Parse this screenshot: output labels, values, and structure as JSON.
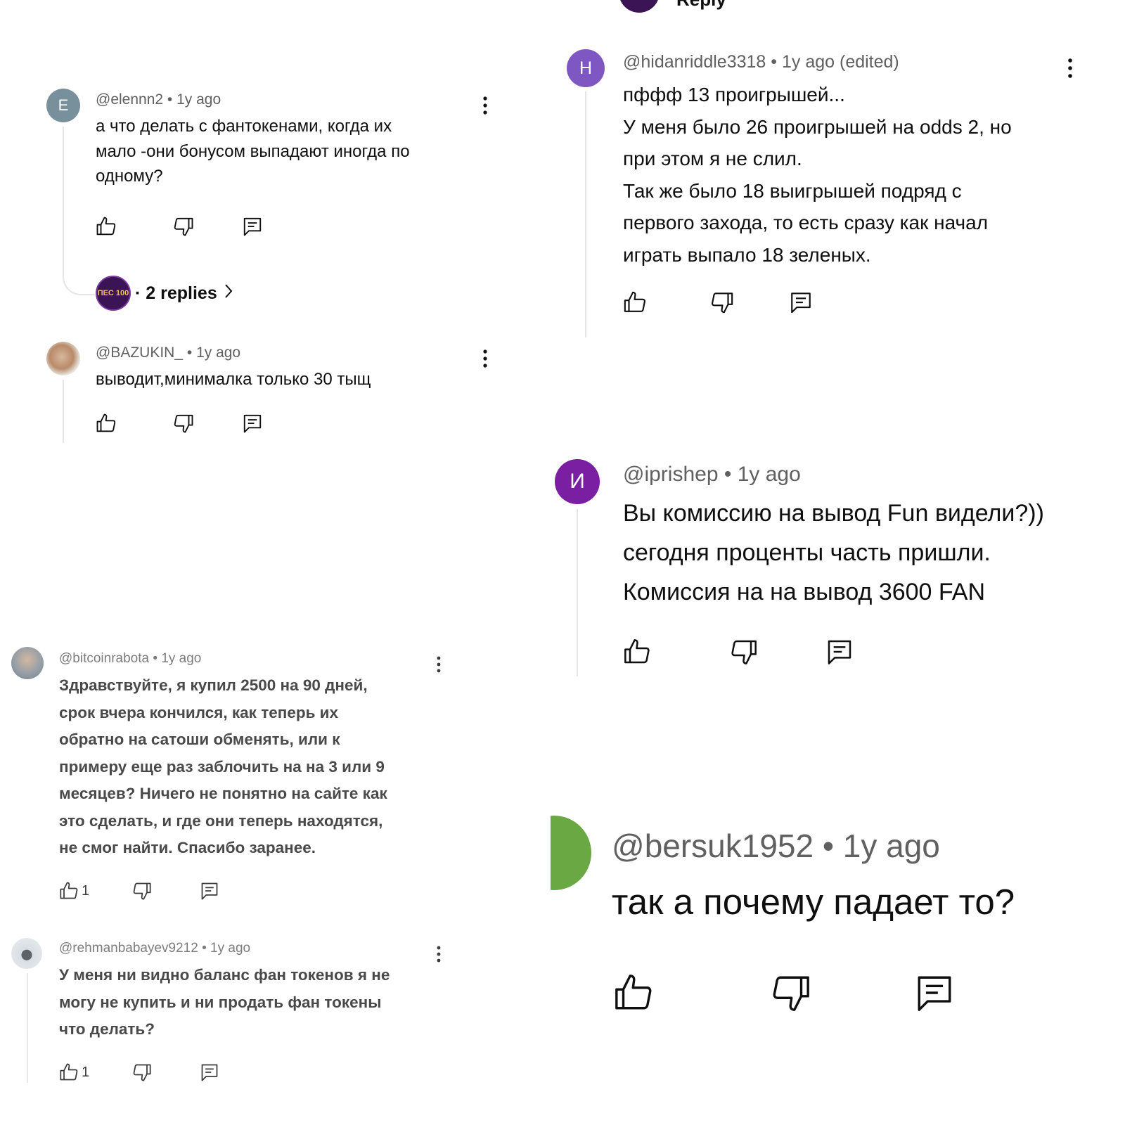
{
  "top_fragment": {
    "text": "Reply"
  },
  "comments": [
    {
      "id": "elennn2",
      "avatar_letter": "E",
      "avatar_color": "#78909c",
      "username": "@elennn2",
      "time": "1y ago",
      "text": "а что делать с фантокенами, когда их\nмало   -они бонусом выпадают иногда по\nодному?",
      "likes": "",
      "replies_label": "· 2 replies",
      "replies_avatar_text": "ПЕС 100"
    },
    {
      "id": "bazukin",
      "avatar_letter": "",
      "avatar_color": "#c9a98a",
      "username": "@BAZUKIN_",
      "time": "1y ago",
      "text": "выводит,минималка только 30 тыщ",
      "likes": ""
    },
    {
      "id": "bitcoinrabota",
      "avatar_letter": "",
      "avatar_color": "#8a8f96",
      "username": "@bitcoinrabota",
      "time": "1y ago",
      "text": "Здравствуйте,  я купил 2500 на 90 дней,\nсрок вчера кончился, как теперь их\nобратно на сатоши обменять, или к\nпримеру еще раз заблочить на на 3 или 9\nмесяцев? Ничего не понятно на сайте как\nэто сделать, и где они теперь находятся,\nне смог найти. Спасибо заранее.",
      "likes": "1"
    },
    {
      "id": "rehmanbabayev",
      "avatar_letter": "",
      "avatar_color": "#9aa3ad",
      "username": "@rehmanbabayev9212",
      "time": "1y ago",
      "text": "У меня ни видно баланс фан токенов я не\nмогу не купить и ни продать фан токены\nчто делать?",
      "likes": "1"
    },
    {
      "id": "hidanriddle",
      "avatar_letter": "H",
      "avatar_color": "#7e57c2",
      "username": "@hidanriddle3318",
      "time": "1y ago (edited)",
      "text": "пффф 13 проигрышей...\nУ меня было 26 проигрышей на odds 2, но\nпри этом я не слил.\nТак же было 18 выигрышей подряд с\nпервого захода, то есть сразу как начал\nиграть выпало 18 зеленых.",
      "likes": ""
    },
    {
      "id": "iprishep",
      "avatar_letter": "И",
      "avatar_color": "#7b1fa2",
      "username": "@iprishep",
      "time": "1y ago",
      "text": "Вы комиссию на вывод Fun видели?))\nсегодня проценты часть пришли.\nКомиссия на на вывод 3600 FAN",
      "likes": ""
    },
    {
      "id": "bersuk",
      "avatar_letter": "",
      "avatar_color": "#6aa843",
      "username": "@bersuk1952",
      "time": "1y ago",
      "text": "так а почему падает то?",
      "likes": ""
    }
  ]
}
